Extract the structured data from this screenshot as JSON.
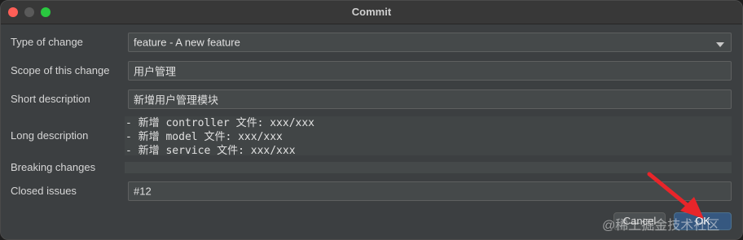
{
  "window": {
    "title": "Commit"
  },
  "form": {
    "type_of_change": {
      "label": "Type of change",
      "value": "feature - A new feature"
    },
    "scope": {
      "label": "Scope of this change",
      "value": "用户管理"
    },
    "short_description": {
      "label": "Short description",
      "value": "新增用户管理模块"
    },
    "long_description": {
      "label": "Long description",
      "lines": [
        "- 新增 controller 文件: xxx/xxx",
        "- 新增 model 文件: xxx/xxx",
        "- 新增 service 文件: xxx/xxx"
      ]
    },
    "breaking_changes": {
      "label": "Breaking changes",
      "value": ""
    },
    "closed_issues": {
      "label": "Closed issues",
      "value": "#12"
    }
  },
  "buttons": {
    "cancel": "Cancel",
    "ok": "OK"
  },
  "watermark": "@稀土掘金技术社区",
  "colors": {
    "window_bg": "#3c3f41",
    "field_bg": "#45494a",
    "ok_button": "#365880",
    "annotation_arrow": "#e8252a"
  }
}
